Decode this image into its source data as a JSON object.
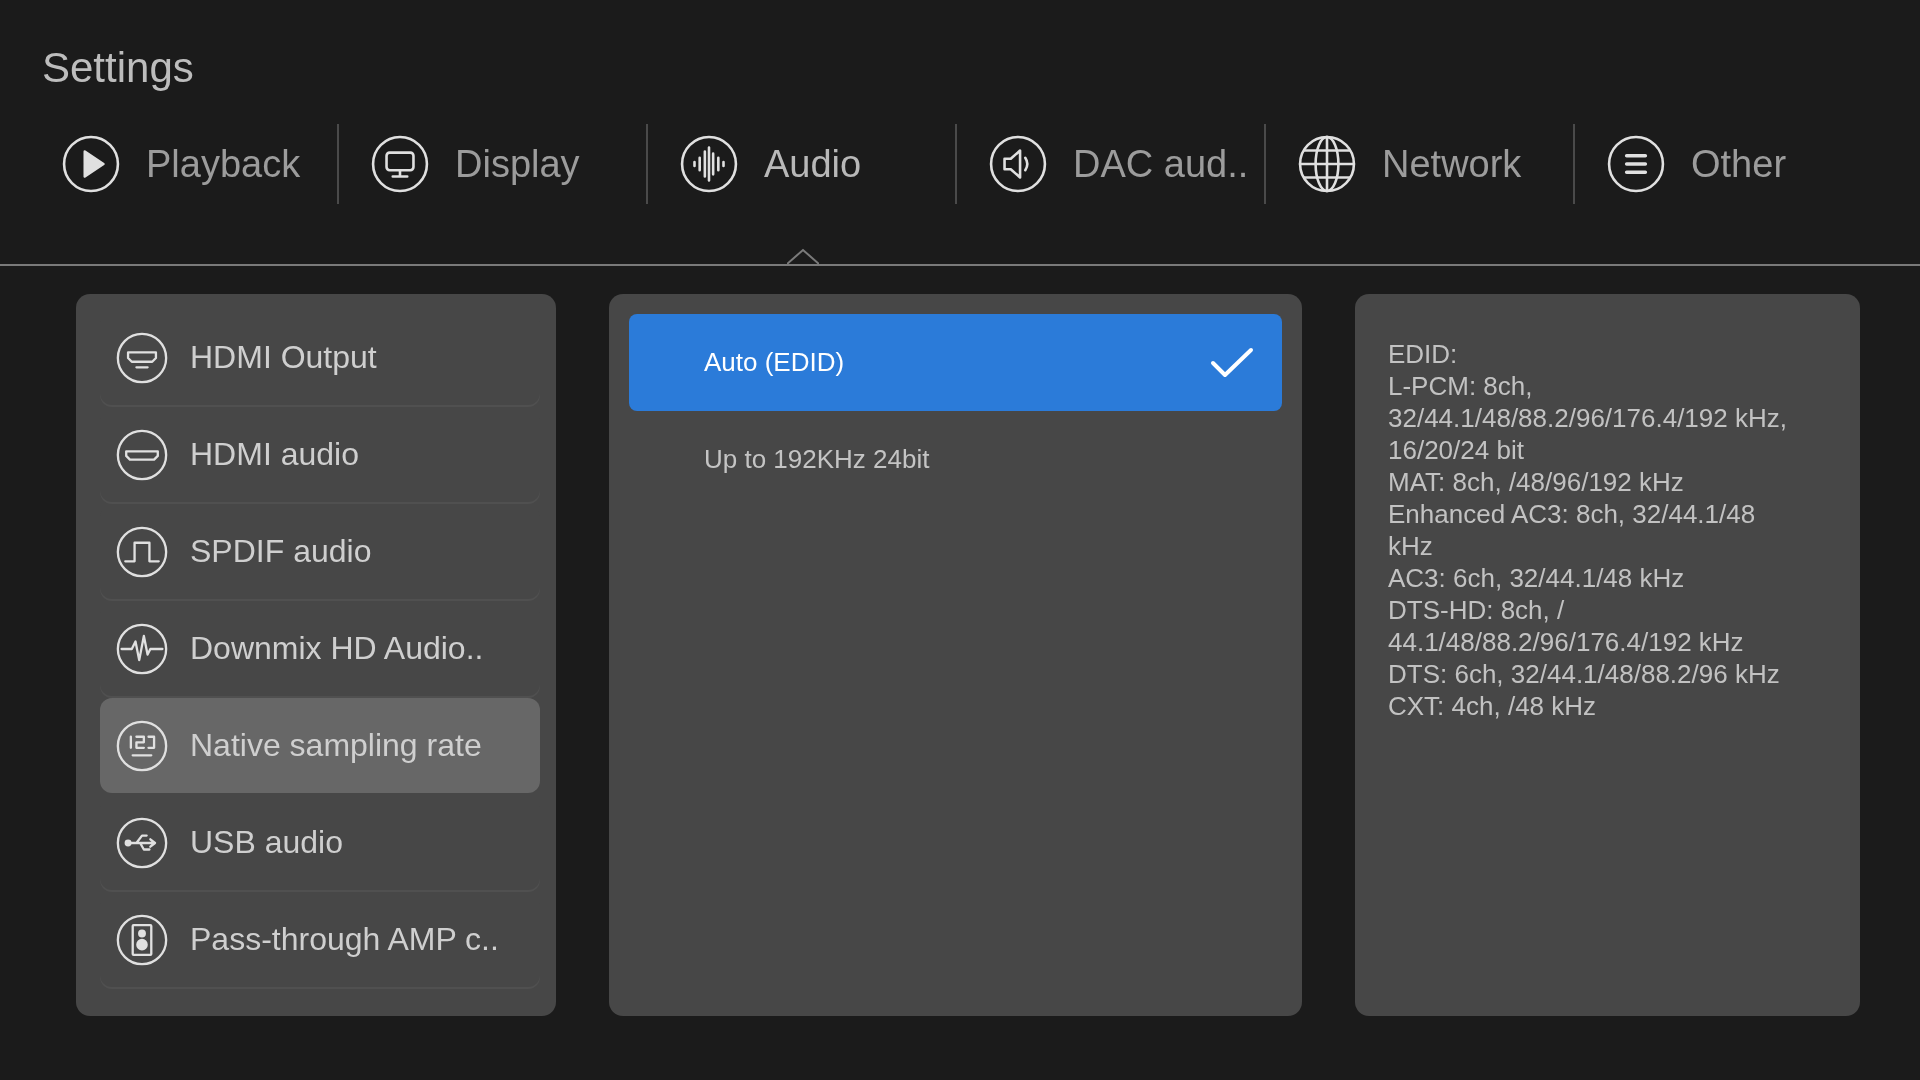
{
  "title": "Settings",
  "tabs": [
    {
      "label": "Playback",
      "selected": false
    },
    {
      "label": "Display",
      "selected": false
    },
    {
      "label": "Audio",
      "selected": true
    },
    {
      "label": "DAC aud..",
      "selected": false
    },
    {
      "label": "Network",
      "selected": false
    },
    {
      "label": "Other",
      "selected": false
    }
  ],
  "menu": [
    {
      "label": "HDMI Output",
      "selected": false
    },
    {
      "label": "HDMI audio",
      "selected": false
    },
    {
      "label": "SPDIF audio",
      "selected": false
    },
    {
      "label": "Downmix HD Audio..",
      "selected": false
    },
    {
      "label": "Native sampling rate",
      "selected": true
    },
    {
      "label": "USB audio",
      "selected": false
    },
    {
      "label": "Pass-through AMP c..",
      "selected": false
    }
  ],
  "options": [
    {
      "label": "Auto (EDID)",
      "selected": true
    },
    {
      "label": "Up to 192KHz 24bit",
      "selected": false
    }
  ],
  "info": [
    "EDID:",
    "L-PCM: 8ch, 32/44.1/48/88.2/96/176.4/192 kHz, 16/20/24 bit",
    "MAT: 8ch, /48/96/192 kHz",
    "Enhanced AC3: 8ch, 32/44.1/48 kHz",
    "AC3: 6ch, 32/44.1/48 kHz",
    "DTS-HD: 8ch, / 44.1/48/88.2/96/176.4/192 kHz",
    "DTS: 6ch, 32/44.1/48/88.2/96 kHz",
    "CXT: 4ch, /48 kHz"
  ]
}
